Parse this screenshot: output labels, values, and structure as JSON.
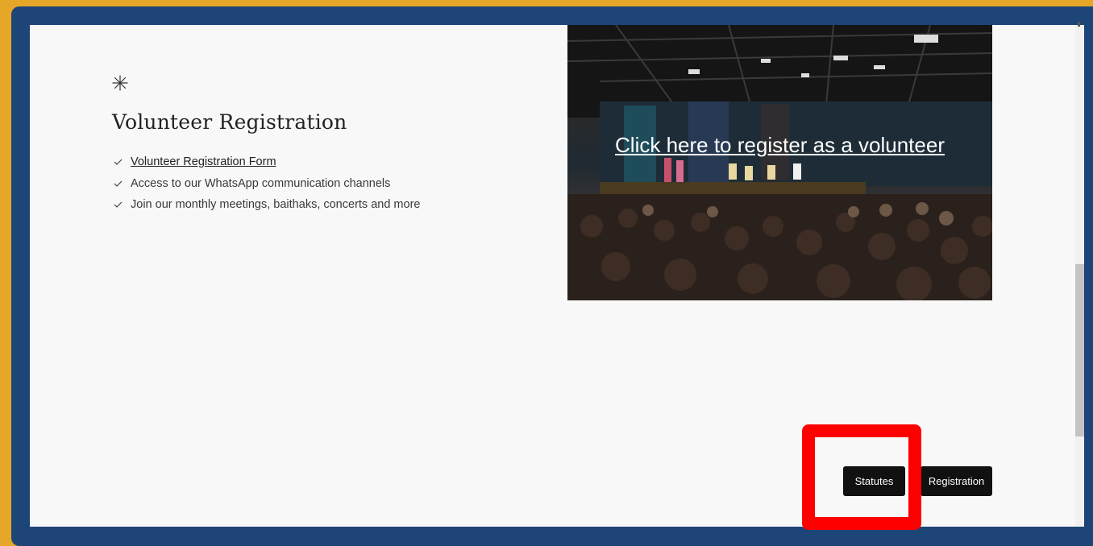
{
  "section": {
    "heading": "Volunteer Registration",
    "items": [
      {
        "label": "Volunteer Registration Form",
        "is_link": true
      },
      {
        "label": "Access to our WhatsApp communication channels",
        "is_link": false
      },
      {
        "label": "Join our monthly meetings, baithaks, concerts and more",
        "is_link": false
      }
    ]
  },
  "hero": {
    "link_text": "Click here to register as a volunteer"
  },
  "buttons": {
    "statutes": "Statutes",
    "registration": "Registration"
  },
  "colors": {
    "outer_border": "#e6a628",
    "frame": "#1e4577",
    "page_background": "#f8f8f8",
    "button": "#111111",
    "highlight": "#ff0000"
  },
  "icons": {
    "sparkle": "sparkle-icon",
    "check": "check-icon"
  }
}
